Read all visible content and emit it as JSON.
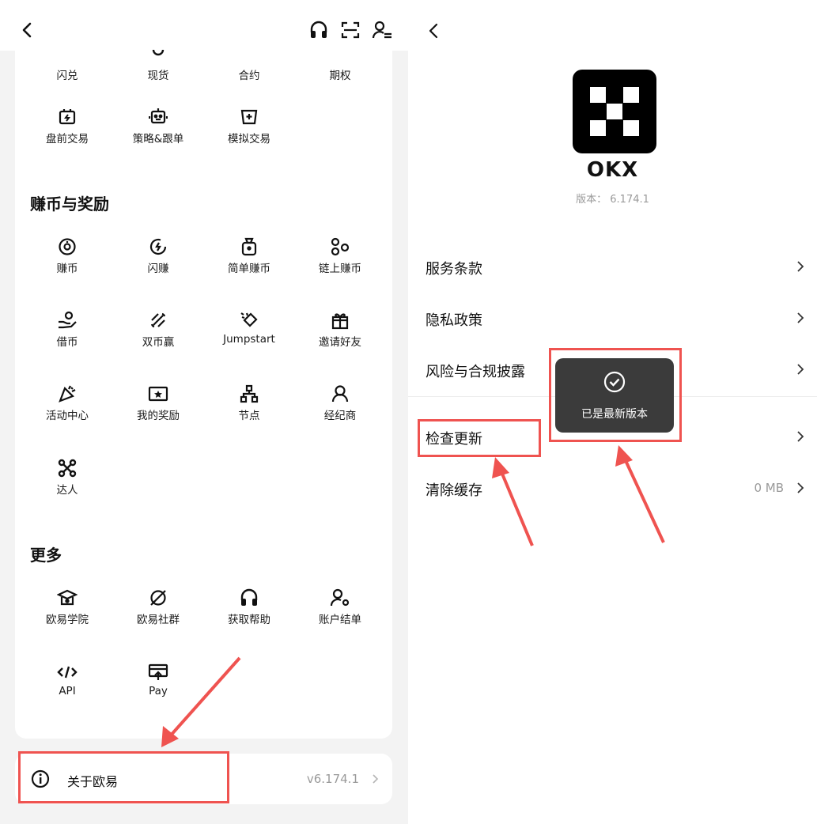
{
  "left": {
    "top_icons": [
      "headset-icon",
      "scan-icon",
      "switch-account-icon"
    ],
    "rows_first": [
      {
        "label": "闪兑",
        "icon": "swap-icon"
      },
      {
        "label": "现货",
        "icon": "spot-icon"
      },
      {
        "label": "合约",
        "icon": "futures-icon"
      },
      {
        "label": "期权",
        "icon": "options-icon"
      }
    ],
    "trade_row2": [
      {
        "label": "盘前交易",
        "icon": "premarket-icon"
      },
      {
        "label": "策略&跟单",
        "icon": "bot-icon"
      },
      {
        "label": "模拟交易",
        "icon": "demo-icon"
      }
    ],
    "earn_title": "赚币与奖励",
    "earn": [
      {
        "label": "赚币",
        "icon": "coin-icon"
      },
      {
        "label": "闪赚",
        "icon": "flash-earn-icon"
      },
      {
        "label": "简单赚币",
        "icon": "moneybag-icon"
      },
      {
        "label": "链上赚币",
        "icon": "onchain-icon"
      },
      {
        "label": "借币",
        "icon": "loan-icon"
      },
      {
        "label": "双币赢",
        "icon": "dual-coin-icon"
      },
      {
        "label": "Jumpstart",
        "icon": "jumpstart-icon"
      },
      {
        "label": "邀请好友",
        "icon": "gift-icon"
      },
      {
        "label": "活动中心",
        "icon": "party-icon"
      },
      {
        "label": "我的奖励",
        "icon": "ticket-icon"
      },
      {
        "label": "节点",
        "icon": "node-icon"
      },
      {
        "label": "经纪商",
        "icon": "broker-icon"
      },
      {
        "label": "达人",
        "icon": "influencer-icon"
      }
    ],
    "more_title": "更多",
    "more": [
      {
        "label": "欧易学院",
        "icon": "academy-icon"
      },
      {
        "label": "欧易社群",
        "icon": "community-icon"
      },
      {
        "label": "获取帮助",
        "icon": "help-icon"
      },
      {
        "label": "账户结单",
        "icon": "statement-icon"
      },
      {
        "label": "API",
        "icon": "code-icon"
      },
      {
        "label": "Pay",
        "icon": "pay-icon"
      }
    ],
    "about": {
      "label": "关于欧易",
      "version": "v6.174.1"
    }
  },
  "right": {
    "brand": "OKX",
    "version_label": "版本：",
    "version_value": "6.174.1",
    "menu": [
      {
        "label": "服务条款",
        "value": ""
      },
      {
        "label": "隐私政策",
        "value": ""
      },
      {
        "label": "风险与合规披露",
        "value": ""
      },
      {
        "label": "检查更新",
        "value": ""
      },
      {
        "label": "清除缓存",
        "value": "0 MB"
      }
    ],
    "toast": "已是最新版本"
  },
  "colors": {
    "highlight": "#ef5350",
    "toast_bg": "#3b3b3b"
  }
}
